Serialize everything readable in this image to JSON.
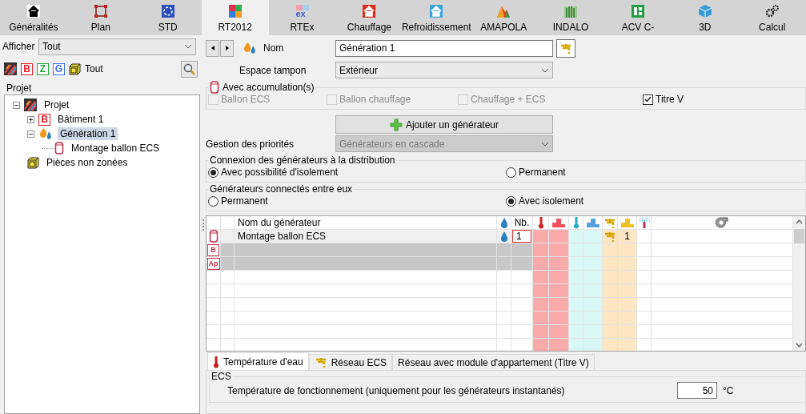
{
  "toolbar": {
    "tabs": [
      {
        "label": "Généralités",
        "selected": false
      },
      {
        "label": "Plan",
        "selected": false
      },
      {
        "label": "STD",
        "selected": false
      },
      {
        "label": "RT2012",
        "selected": true
      },
      {
        "label": "RTEx",
        "selected": false,
        "icon_text": "ex"
      },
      {
        "label": "Chauffage",
        "selected": false
      },
      {
        "label": "Refroidissement",
        "selected": false
      },
      {
        "label": "AMAPOLA",
        "selected": false
      },
      {
        "label": "INDALO",
        "selected": false
      },
      {
        "label": "ACV C-",
        "selected": false
      },
      {
        "label": "3D",
        "selected": false
      },
      {
        "label": "Calcul",
        "selected": false
      }
    ]
  },
  "left": {
    "filter": {
      "label": "Afficher",
      "value": "Tout"
    },
    "type_buttons": [
      {
        "kind": "stripes"
      },
      {
        "kind": "letter",
        "letter": "B",
        "color": "#e8202a"
      },
      {
        "kind": "letter",
        "letter": "Z",
        "color": "#1fa83a"
      },
      {
        "kind": "letter",
        "letter": "G",
        "color": "#3a6ee8"
      },
      {
        "kind": "cube"
      }
    ],
    "all_label": "Tout",
    "tree_title": "Projet",
    "tree": [
      {
        "label": "Projet",
        "kind": "stripes",
        "expanded": true,
        "selected": false,
        "children": [
          {
            "label": "Bâtiment 1",
            "kind": "letter",
            "letter": "B",
            "expanded": false,
            "selected": false
          },
          {
            "label": "Génération 1",
            "kind": "generation",
            "expanded": true,
            "selected": true,
            "children": [
              {
                "label": "Montage ballon ECS",
                "kind": "tank",
                "selected": false
              }
            ]
          },
          {
            "label": "Pièces non zonées",
            "kind": "cube",
            "selected": false
          }
        ]
      }
    ]
  },
  "form": {
    "name_label": "Nom",
    "name_value": "Génération 1",
    "buffer_label": "Espace tampon",
    "buffer_value": "Extérieur",
    "accumulation": {
      "title": "Avec accumulation(s)",
      "options": [
        {
          "label": "Ballon ECS",
          "checked": false,
          "disabled": true
        },
        {
          "label": "Ballon chauffage",
          "checked": false,
          "disabled": true
        },
        {
          "label": "Chauffage + ECS",
          "checked": false,
          "disabled": true
        },
        {
          "label": "Titre V",
          "checked": true,
          "disabled": false
        }
      ]
    },
    "add_button": "Ajouter un générateur",
    "priority": {
      "label": "Gestion des priorités",
      "value": "Générateurs en cascade",
      "disabled": true
    },
    "radio_groups": [
      {
        "title": "Connexion des générateurs à la distribution",
        "options": [
          {
            "label": "Avec possibilité d'isolement",
            "selected": true
          },
          {
            "label": "Permanent",
            "selected": false
          }
        ]
      },
      {
        "title": "Générateurs connectés entre eux",
        "options": [
          {
            "label": "Permanent",
            "selected": false
          },
          {
            "label": "Avec isolement",
            "selected": true
          }
        ]
      }
    ]
  },
  "table": {
    "columns": [
      {
        "kind": "blank"
      },
      {
        "kind": "blank"
      },
      {
        "kind": "text",
        "label": "Nom du générateur"
      },
      {
        "kind": "drop"
      },
      {
        "kind": "text",
        "label": "Nb."
      },
      {
        "kind": "thermometer",
        "color": "#f9aaaa"
      },
      {
        "kind": "podium",
        "color": "#f9aaaa"
      },
      {
        "kind": "thermometer",
        "color": "#d9f7f4"
      },
      {
        "kind": "podium",
        "color": "#d9f7f4"
      },
      {
        "kind": "tap",
        "color": "#fde6c4"
      },
      {
        "kind": "podium",
        "color": "#fde6c4"
      },
      {
        "kind": "sprinkler"
      },
      {
        "kind": "pump"
      }
    ],
    "rows": [
      {
        "kind": "tank",
        "name": "Montage ballon ECS",
        "count": "1",
        "tap_count": "1",
        "disabled": false
      },
      {
        "kind": "letter",
        "letter": "B",
        "disabled": true
      },
      {
        "kind": "letter",
        "letter": "Ap",
        "disabled": true
      }
    ]
  },
  "bottom": {
    "tabs": [
      {
        "label": "Température d'eau",
        "selected": true
      },
      {
        "label": "Réseau ECS",
        "selected": false
      },
      {
        "label": "Réseau avec module d'appartement (Titre V)",
        "selected": false
      }
    ],
    "section": "ECS",
    "field_label": "Température de fonctionnement (uniquement pour les générateurs instantanés)",
    "field_value": "50",
    "unit": "°C"
  }
}
